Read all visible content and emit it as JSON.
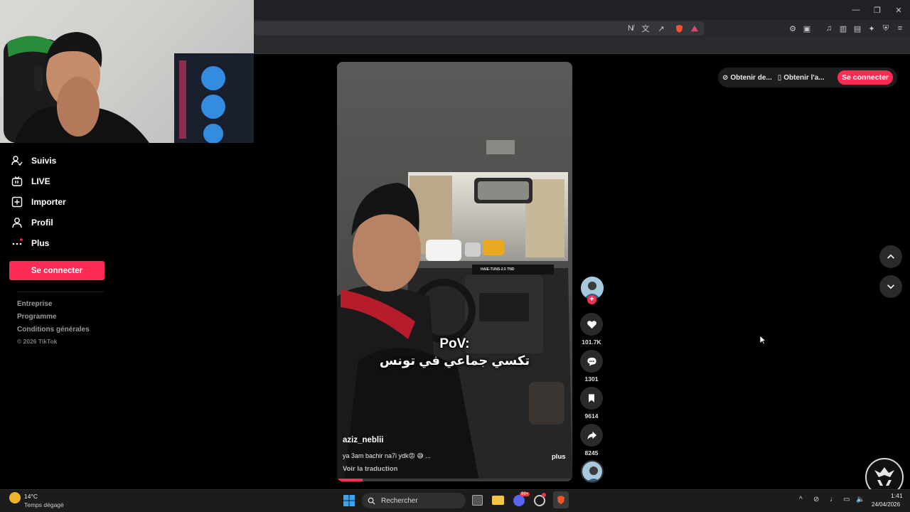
{
  "browser": {
    "window_controls": [
      "—",
      "❐",
      "✕"
    ]
  },
  "sidebar": {
    "items": [
      {
        "name": "following",
        "label": "Suivis"
      },
      {
        "name": "live",
        "label": "LIVE"
      },
      {
        "name": "upload",
        "label": "Importer"
      },
      {
        "name": "profile",
        "label": "Profil"
      },
      {
        "name": "more",
        "label": "Plus"
      }
    ],
    "login_label": "Se connecter",
    "footer": [
      "Entreprise",
      "Programme",
      "Conditions générales",
      "© 2026 TikTok"
    ]
  },
  "top_bar": {
    "get_app_label": "Obtenir de...",
    "get_app2_label": "Obtenir l'a...",
    "login_label": "Se connecter"
  },
  "video": {
    "caption_line1": "PoV:",
    "caption_line2": "تكسي جماعي في تونس",
    "van_sign": "HAIE-TUNS-2.5 TND",
    "author": "aziz_neblii",
    "description": "ya 3am bachir na7i ydk😡 😅 ...",
    "more_label": "plus",
    "translate_label": "Voir la traduction",
    "progress": 0.11
  },
  "actions": {
    "likes": "101.7K",
    "comments": "1301",
    "saves": "9614",
    "shares": "8245"
  },
  "taskbar": {
    "weather_temp": "14°C",
    "weather_desc": "Temps dégagé",
    "search_placeholder": "Rechercher",
    "time": "1:41",
    "date": "24/04/2026",
    "badge": "99+"
  },
  "colors": {
    "accent": "#fe2c55",
    "background": "#000000",
    "taskbar": "#1c1c1c"
  }
}
